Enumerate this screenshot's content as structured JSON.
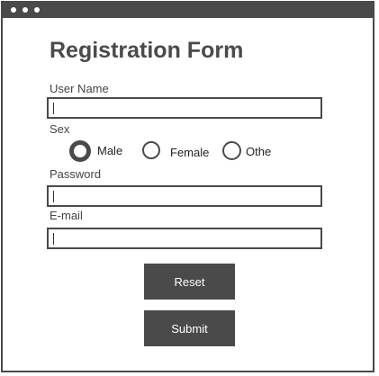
{
  "window": {
    "title_bar_dots": [
      "window-dot-1",
      "window-dot-2",
      "window-dot-3"
    ]
  },
  "form": {
    "title": "Registration Form",
    "username": {
      "label": "User Name",
      "value": ""
    },
    "sex": {
      "label": "Sex",
      "options": [
        {
          "label": "Male",
          "checked": true
        },
        {
          "label": "Female",
          "checked": false
        },
        {
          "label": "Othe",
          "checked": false
        }
      ]
    },
    "password": {
      "label": "Password",
      "value": ""
    },
    "email": {
      "label": "E-mail",
      "value": ""
    },
    "buttons": {
      "reset_label": "Reset",
      "submit_label": "Submit"
    }
  },
  "colors": {
    "frame": "#4a4a4a",
    "button_bg": "#4a4a4a",
    "button_text": "#ffffff",
    "background": "#ffffff"
  }
}
